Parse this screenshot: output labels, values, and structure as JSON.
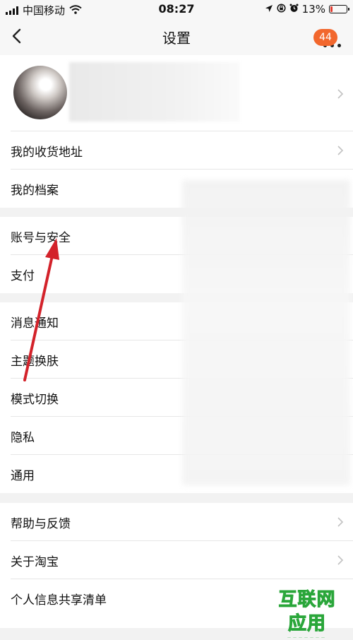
{
  "status_bar": {
    "carrier": "中国移动",
    "time": "08:27",
    "battery_percent": "13%",
    "battery_level": 0.13,
    "icons": [
      "signal-icon",
      "wifi-icon",
      "location-icon",
      "screen-lock-icon",
      "alarm-icon",
      "battery-icon"
    ]
  },
  "nav": {
    "title": "设置",
    "badge_count": "44",
    "back_icon": "chevron-left-icon",
    "more_icon": "more-dots-icon"
  },
  "sections": [
    {
      "items": [
        {
          "label": "我的收货地址",
          "chevron": true
        },
        {
          "label": "我的档案",
          "chevron": false
        }
      ]
    },
    {
      "items": [
        {
          "label": "账号与安全",
          "chevron": false
        },
        {
          "label": "支付",
          "chevron": false
        }
      ]
    },
    {
      "items": [
        {
          "label": "消息通知",
          "chevron": false
        },
        {
          "label": "主题换肤",
          "chevron": false
        },
        {
          "label": "模式切换",
          "chevron": false
        },
        {
          "label": "隐私",
          "chevron": false
        },
        {
          "label": "通用",
          "chevron": false
        }
      ]
    },
    {
      "items": [
        {
          "label": "帮助与反馈",
          "chevron": true
        },
        {
          "label": "关于淘宝",
          "chevron": true
        },
        {
          "label": "个人信息共享清单",
          "chevron": false
        }
      ]
    }
  ],
  "colors": {
    "accent_badge": "#f2672d",
    "annotation_arrow": "#d3222a",
    "watermark": "#39c24a"
  },
  "watermark": {
    "text": "互联网应用"
  }
}
